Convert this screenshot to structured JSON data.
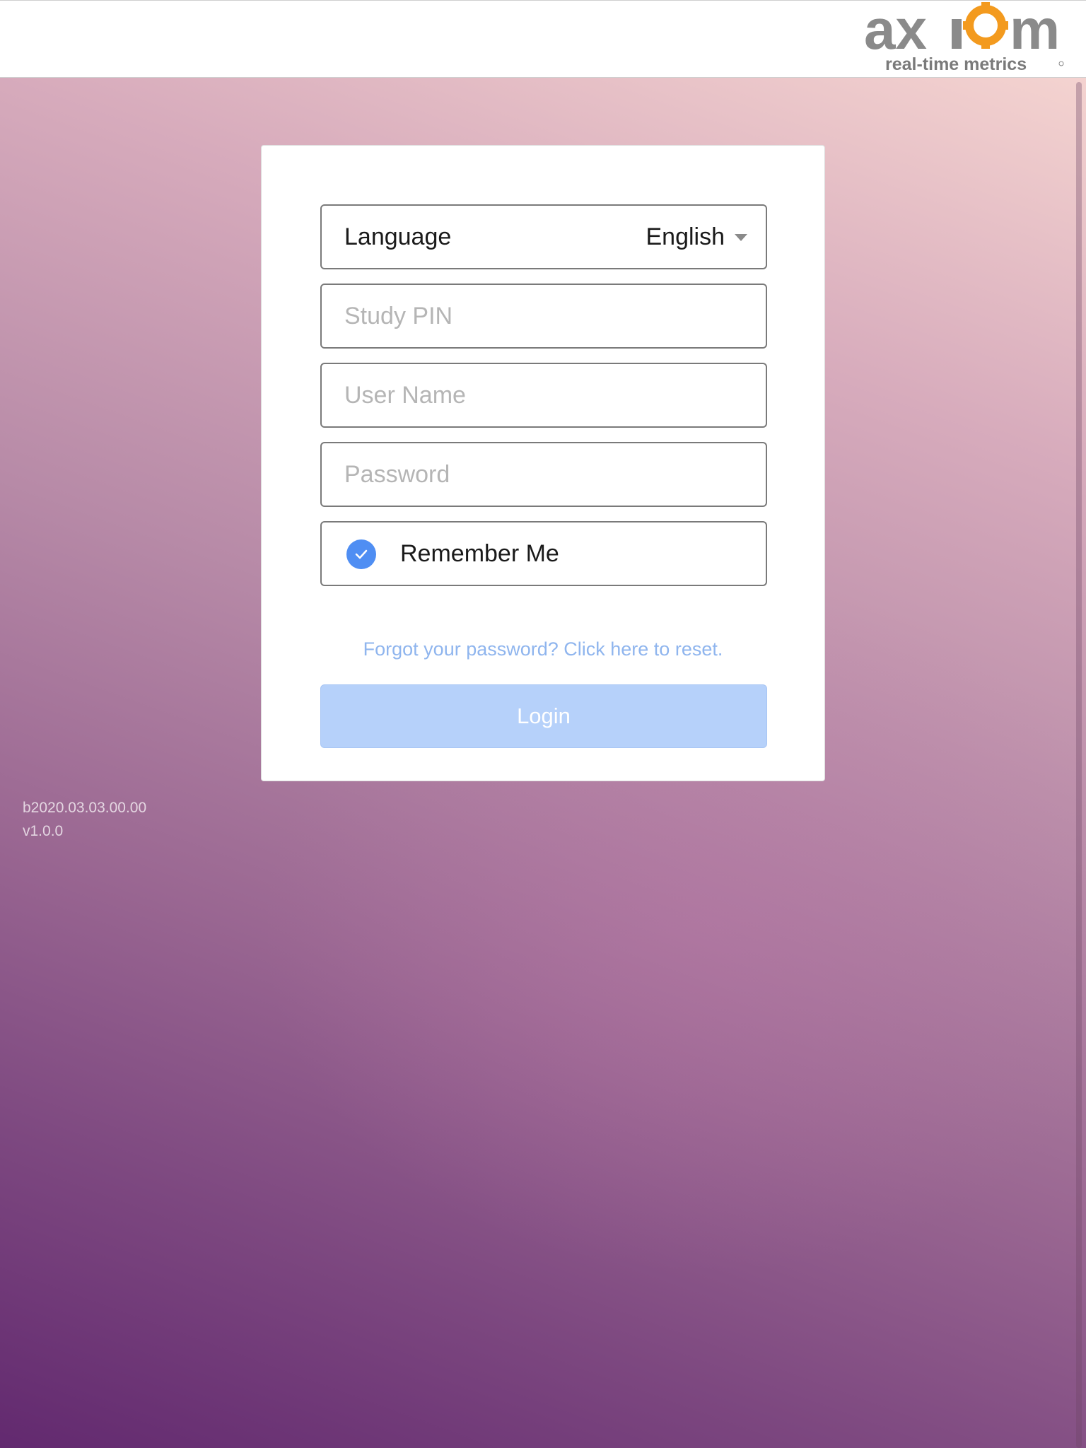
{
  "header": {
    "logo": {
      "wordmark": "axiom",
      "tagline": "real-time metrics",
      "brand_gray": "#8a8a8a",
      "brand_orange": "#f39a1e"
    }
  },
  "login_form": {
    "language": {
      "label": "Language",
      "selected": "English"
    },
    "study_pin": {
      "placeholder": "Study PIN",
      "value": ""
    },
    "user_name": {
      "placeholder": "User Name",
      "value": ""
    },
    "password": {
      "placeholder": "Password",
      "value": ""
    },
    "remember_me": {
      "label": "Remember Me",
      "checked": true
    },
    "forgot_link": "Forgot your password? Click here to reset.",
    "login_button": "Login"
  },
  "footer": {
    "build": "b2020.03.03.00.00",
    "version": "v1.0.0"
  },
  "colors": {
    "accent": "#4f8ef3",
    "login_disabled": "#b6d1fa",
    "link": "#8fb5ee"
  }
}
